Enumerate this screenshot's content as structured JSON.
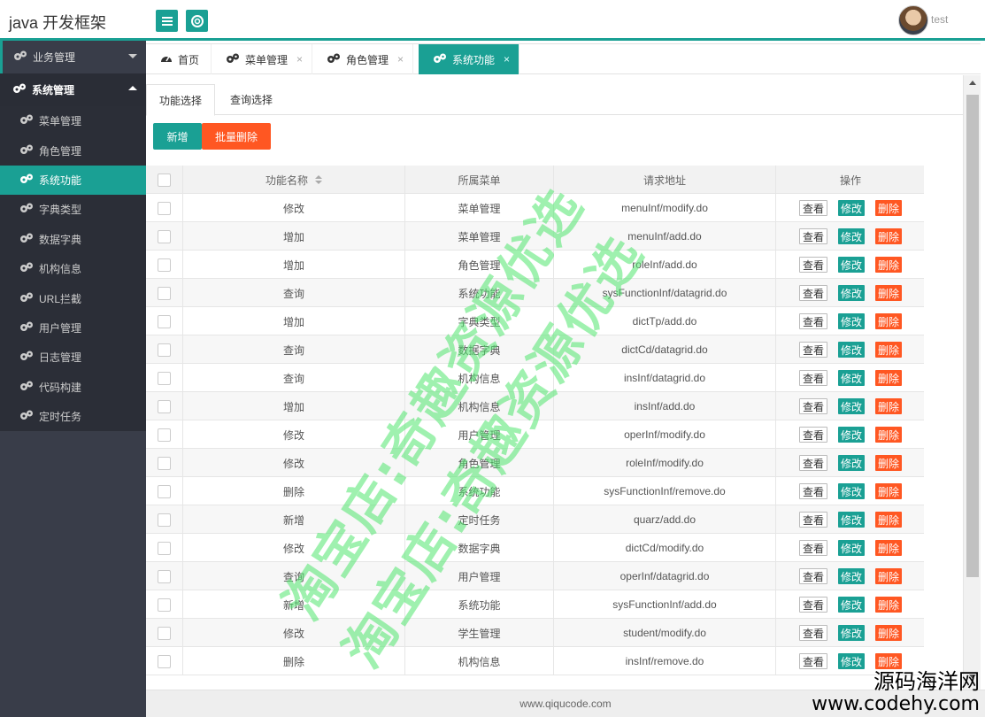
{
  "header": {
    "title": "java 开发框架",
    "username": "test"
  },
  "sidebar": {
    "groups": [
      {
        "label": "业务管理"
      },
      {
        "label": "系统管理"
      }
    ],
    "items": [
      {
        "label": "菜单管理"
      },
      {
        "label": "角色管理"
      },
      {
        "label": "系统功能"
      },
      {
        "label": "字典类型"
      },
      {
        "label": "数据字典"
      },
      {
        "label": "机构信息"
      },
      {
        "label": "URL拦截"
      },
      {
        "label": "用户管理"
      },
      {
        "label": "日志管理"
      },
      {
        "label": "代码构建"
      },
      {
        "label": "定时任务"
      }
    ]
  },
  "tabs": [
    {
      "label": "首页"
    },
    {
      "label": "菜单管理",
      "close": "×"
    },
    {
      "label": "角色管理",
      "close": "×"
    },
    {
      "label": "系统功能",
      "close": "×"
    }
  ],
  "subtabs": {
    "function": "功能选择",
    "query": "查询选择"
  },
  "actions": {
    "add": "新增",
    "batch_delete": "批量删除"
  },
  "table": {
    "headers": {
      "name": "功能名称",
      "menu": "所属菜单",
      "url": "请求地址",
      "ops": "操作"
    },
    "ops": {
      "view": "查看",
      "edit": "修改",
      "delete": "删除"
    },
    "rows": [
      {
        "name": "修改",
        "menu": "菜单管理",
        "url": "menuInf/modify.do"
      },
      {
        "name": "增加",
        "menu": "菜单管理",
        "url": "menuInf/add.do"
      },
      {
        "name": "增加",
        "menu": "角色管理",
        "url": "roleInf/add.do"
      },
      {
        "name": "查询",
        "menu": "系统功能",
        "url": "sysFunctionInf/datagrid.do"
      },
      {
        "name": "增加",
        "menu": "字典类型",
        "url": "dictTp/add.do"
      },
      {
        "name": "查询",
        "menu": "数据字典",
        "url": "dictCd/datagrid.do"
      },
      {
        "name": "查询",
        "menu": "机构信息",
        "url": "insInf/datagrid.do"
      },
      {
        "name": "增加",
        "menu": "机构信息",
        "url": "insInf/add.do"
      },
      {
        "name": "修改",
        "menu": "用户管理",
        "url": "operInf/modify.do"
      },
      {
        "name": "修改",
        "menu": "角色管理",
        "url": "roleInf/modify.do"
      },
      {
        "name": "删除",
        "menu": "系统功能",
        "url": "sysFunctionInf/remove.do"
      },
      {
        "name": "新增",
        "menu": "定时任务",
        "url": "quarz/add.do"
      },
      {
        "name": "修改",
        "menu": "数据字典",
        "url": "dictCd/modify.do"
      },
      {
        "name": "查询",
        "menu": "用户管理",
        "url": "operInf/datagrid.do"
      },
      {
        "name": "新增",
        "menu": "系统功能",
        "url": "sysFunctionInf/add.do"
      },
      {
        "name": "修改",
        "menu": "学生管理",
        "url": "student/modify.do"
      },
      {
        "name": "删除",
        "menu": "机构信息",
        "url": "insInf/remove.do"
      }
    ]
  },
  "footer": {
    "text": "www.qiqucode.com"
  },
  "watermark": {
    "line1": "淘宝店:奇趣资源优选",
    "line2": "淘宝店:奇趣资源优选"
  },
  "brand": {
    "line1": "源码海洋网",
    "line2": "www.codehy.com"
  },
  "colors": {
    "accent": "#1aa094",
    "danger": "#ff5722",
    "sidebar": "#393d49"
  }
}
